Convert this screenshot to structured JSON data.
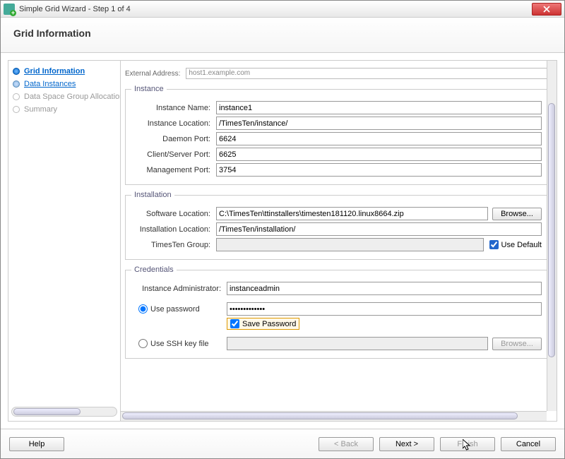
{
  "window": {
    "title": "Simple Grid Wizard - Step 1 of 4"
  },
  "header": {
    "title": "Grid Information"
  },
  "sidebar": {
    "steps": [
      {
        "label": "Grid Information",
        "state": "active"
      },
      {
        "label": "Data Instances",
        "state": "link"
      },
      {
        "label": "Data Space Group Allocation",
        "state": "dim"
      },
      {
        "label": "Summary",
        "state": "dim"
      }
    ]
  },
  "top_truncated": {
    "label": "External Address:",
    "value": "host1.example.com"
  },
  "instance": {
    "legend": "Instance",
    "name_label": "Instance Name:",
    "name_value": "instance1",
    "location_label": "Instance Location:",
    "location_value": "/TimesTen/instance/",
    "daemon_label": "Daemon Port:",
    "daemon_value": "6624",
    "cs_label": "Client/Server Port:",
    "cs_value": "6625",
    "mgmt_label": "Management Port:",
    "mgmt_value": "3754"
  },
  "installation": {
    "legend": "Installation",
    "software_label": "Software Location:",
    "software_value": "C:\\TimesTen\\ttinstallers\\timesten181120.linux8664.zip",
    "browse": "Browse...",
    "install_label": "Installation Location:",
    "install_value": "/TimesTen/installation/",
    "group_label": "TimesTen Group:",
    "group_value": "",
    "use_default": "Use Default"
  },
  "credentials": {
    "legend": "Credentials",
    "admin_label": "Instance Administrator:",
    "admin_value": "instanceadmin",
    "use_password": "Use password",
    "password_value": "•••••••••••••",
    "save_password": "Save Password",
    "use_ssh": "Use SSH key file",
    "browse": "Browse..."
  },
  "footer": {
    "help": "Help",
    "back": "< Back",
    "next": "Next >",
    "finish": "Finish",
    "cancel": "Cancel"
  }
}
